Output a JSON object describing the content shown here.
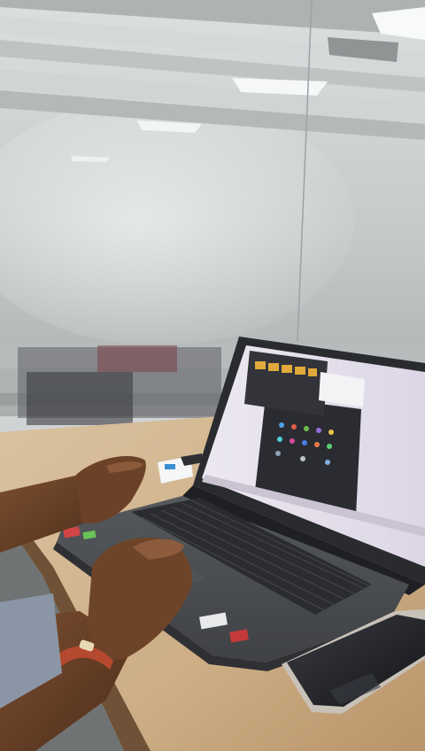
{
  "scene": {
    "description_free": true,
    "elements": {
      "ceiling": "ceiling",
      "frosted_glass": "frosted-glass-wall",
      "desk": "wooden-desk",
      "laptop": "laptop",
      "laptop_screen": "laptop-screen",
      "keyboard": "laptop-keyboard",
      "touchpad": "touchpad",
      "left_hand": "left-hand",
      "right_hand": "right-hand",
      "phone": "smartphone",
      "card": "small-card"
    }
  },
  "colors": {
    "glass": "#c9cfcf",
    "desk": "#d2b48c",
    "laptop_body": "#4a4c50",
    "screen_bg": "#e6e1ec",
    "start_menu": "#2b2c31",
    "skin": "#6b4228",
    "phone": "#222326"
  }
}
